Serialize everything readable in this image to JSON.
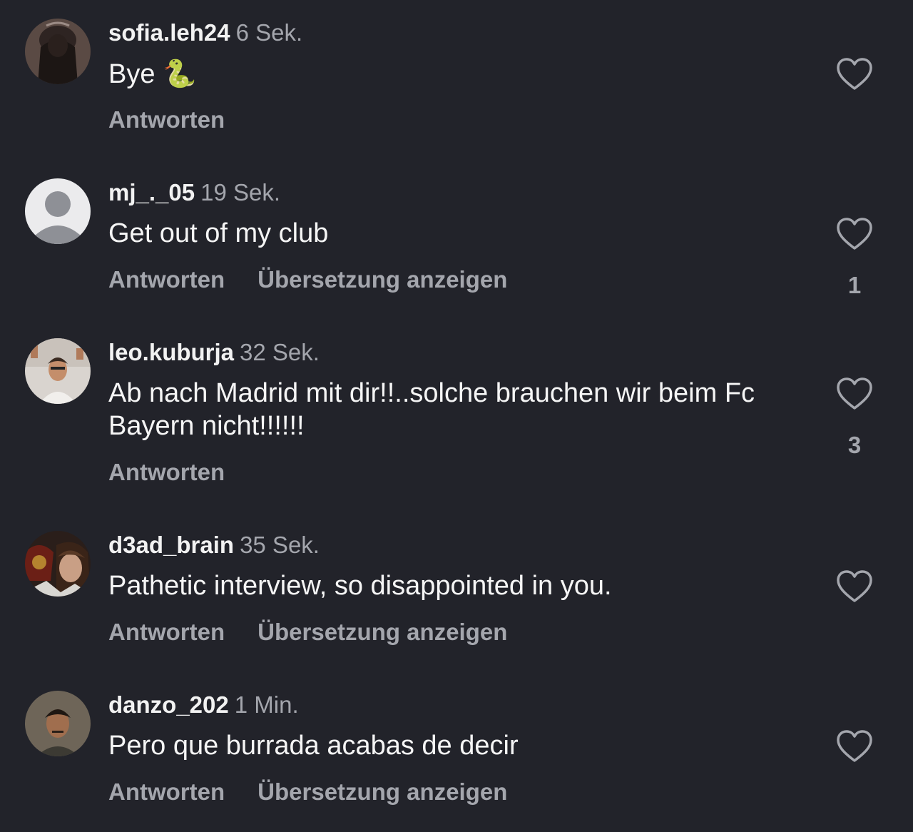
{
  "comments": [
    {
      "username": "sofia.leh24",
      "time": "6 Sek.",
      "text": "Bye",
      "emoji": "🐍",
      "reply_label": "Antworten",
      "translate_label": "",
      "like_icon": "heart-outline-icon",
      "likes": ""
    },
    {
      "username": "mj_._05",
      "time": "19 Sek.",
      "text": "Get out of my club",
      "reply_label": "Antworten",
      "translate_label": "Übersetzung anzeigen",
      "like_icon": "heart-outline-icon",
      "likes": "1"
    },
    {
      "username": "leo.kuburja",
      "time": "32 Sek.",
      "text": "Ab nach Madrid mit dir!!..solche brauchen wir beim Fc Bayern nicht!!!!!!",
      "reply_label": "Antworten",
      "translate_label": "",
      "like_icon": "heart-outline-icon",
      "likes": "3"
    },
    {
      "username": "d3ad_brain",
      "time": "35 Sek.",
      "text": "Pathetic interview, so disappointed in you.",
      "reply_label": "Antworten",
      "translate_label": "Übersetzung anzeigen",
      "like_icon": "heart-outline-icon",
      "likes": ""
    },
    {
      "username": "danzo_202",
      "time": "1 Min.",
      "text": "Pero que burrada acabas de decir",
      "reply_label": "Antworten",
      "translate_label": "Übersetzung anzeigen",
      "like_icon": "heart-outline-icon",
      "likes": ""
    }
  ],
  "colors": {
    "background": "#22232a",
    "text_primary": "#f5f5f5",
    "text_secondary": "#a4a6ad"
  }
}
